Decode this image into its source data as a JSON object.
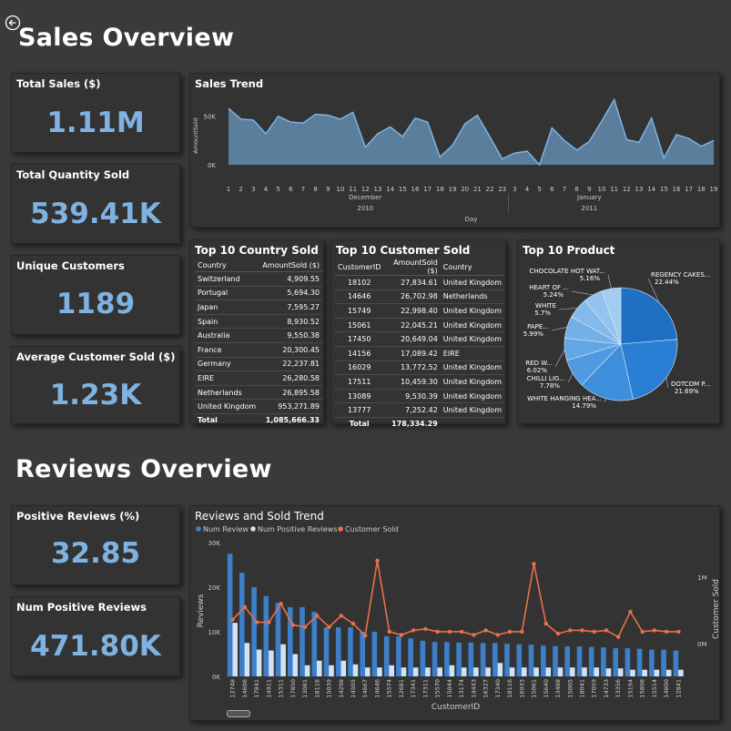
{
  "sales_overview": {
    "title": "Sales Overview",
    "kpis": [
      {
        "label": "Total Sales ($)",
        "value": "1.11M"
      },
      {
        "label": "Total Quantity Sold",
        "value": "539.41K"
      },
      {
        "label": "Unique Customers",
        "value": "1189"
      },
      {
        "label": "Average Customer Sold ($)",
        "value": "1.23K"
      }
    ],
    "sales_trend": {
      "title": "Sales Trend",
      "chart_data": {
        "type": "area",
        "ylabel": "AmountSold",
        "xlabel": "Day",
        "y_ticks": [
          "0K",
          "50K"
        ],
        "ylim": [
          0,
          75000
        ],
        "x": [
          "1",
          "2",
          "3",
          "4",
          "5",
          "6",
          "7",
          "8",
          "9",
          "10",
          "11",
          "12",
          "13",
          "14",
          "15",
          "16",
          "17",
          "18",
          "19",
          "20",
          "21",
          "22",
          "23",
          "3",
          "4",
          "5",
          "6",
          "7",
          "8",
          "9",
          "10",
          "11",
          "12",
          "13",
          "14",
          "15",
          "16",
          "17",
          "18",
          "19"
        ],
        "months": [
          {
            "label": "December",
            "year": "2010"
          },
          {
            "label": "January",
            "year": "2011"
          }
        ],
        "values": [
          58000,
          47000,
          46000,
          32000,
          50000,
          44000,
          43000,
          52000,
          51000,
          47000,
          54000,
          18000,
          32000,
          39000,
          29000,
          48000,
          44000,
          8000,
          20000,
          42000,
          51000,
          29000,
          6000,
          12000,
          14000,
          0,
          38000,
          25000,
          15000,
          24000,
          45000,
          67000,
          26000,
          23000,
          48000,
          7000,
          31000,
          27000,
          19000,
          25000
        ]
      }
    },
    "country_table": {
      "title": "Top 10 Country Sold",
      "columns": [
        "Country",
        "AmountSold ($)"
      ],
      "rows": [
        [
          "Switzerland",
          "4,909.55"
        ],
        [
          "Portugal",
          "5,694.30"
        ],
        [
          "Japan",
          "7,595.27"
        ],
        [
          "Spain",
          "8,930.52"
        ],
        [
          "Australia",
          "9,550.38"
        ],
        [
          "France",
          "20,300.45"
        ],
        [
          "Germany",
          "22,237.81"
        ],
        [
          "EIRE",
          "26,280.58"
        ],
        [
          "Netherlands",
          "26,895.58"
        ],
        [
          "United Kingdom",
          "953,271.89"
        ]
      ],
      "total": [
        "Total",
        "1,085,666.33"
      ]
    },
    "customer_table": {
      "title": "Top 10 Customer Sold",
      "columns": [
        "CustomerID",
        "AmountSold ($)",
        "Country"
      ],
      "rows": [
        [
          "18102",
          "27,834.61",
          "United Kingdom"
        ],
        [
          "14646",
          "26,702.98",
          "Netherlands"
        ],
        [
          "15749",
          "22,998.40",
          "United Kingdom"
        ],
        [
          "15061",
          "22,045.21",
          "United Kingdom"
        ],
        [
          "17450",
          "20,649.04",
          "United Kingdom"
        ],
        [
          "14156",
          "17,089.42",
          "EIRE"
        ],
        [
          "16029",
          "13,772.52",
          "United Kingdom"
        ],
        [
          "17511",
          "10,459.30",
          "United Kingdom"
        ],
        [
          "13089",
          "9,530.39",
          "United Kingdom"
        ],
        [
          "13777",
          "7,252.42",
          "United Kingdom"
        ]
      ],
      "total": [
        "Total",
        "178,334.29",
        ""
      ]
    },
    "top_product": {
      "title": "Top 10 Product",
      "chart_data": {
        "type": "pie",
        "slices": [
          {
            "label": "REGENCY CAKES...",
            "value": 22.44,
            "pct": "22.44%",
            "color": "#1f6fc4"
          },
          {
            "label": "DOTCOM P...",
            "value": 21.69,
            "pct": "21.69%",
            "color": "#2a7fd4"
          },
          {
            "label": "WHITE HANGING HEA...",
            "value": 14.79,
            "pct": "14.79%",
            "color": "#3d8fdc"
          },
          {
            "label": "CHILLI LIG...",
            "value": 7.78,
            "pct": "7.78%",
            "color": "#4f9ae0"
          },
          {
            "label": "RED W...",
            "value": 6.02,
            "pct": "6.02%",
            "color": "#62a6e4"
          },
          {
            "label": "PAPE...",
            "value": 5.99,
            "pct": "5.99%",
            "color": "#73b0e8"
          },
          {
            "label": "WHITE",
            "value": 5.7,
            "pct": "5.7%",
            "color": "#84baeb"
          },
          {
            "label": "HEART OF ...",
            "value": 5.24,
            "pct": "5.24%",
            "color": "#93c3ee"
          },
          {
            "label": "CHOCOLATE HOT WAT...",
            "value": 5.16,
            "pct": "5.16%",
            "color": "#a3ccf1"
          }
        ]
      }
    }
  },
  "reviews_overview": {
    "title": "Reviews Overview",
    "kpis": [
      {
        "label": "Positive Reviews (%)",
        "value": "32.85"
      },
      {
        "label": "Num Positive Reviews",
        "value": "471.80K"
      }
    ],
    "trend": {
      "title": "Reviews and Sold Trend",
      "chart_data": {
        "type": "bar",
        "xlabel": "CustomerID",
        "ylabel": "Reviews",
        "y2label": "Customer Sold",
        "y_ticks": [
          "0K",
          "10K",
          "20K",
          "30K"
        ],
        "ylim": [
          0,
          30000
        ],
        "y2_ticks": [
          "0M",
          "1M"
        ],
        "legend": [
          "Num Review",
          "Num Positive Reviews",
          "Customer Sold"
        ],
        "colors": {
          "num_review": "#3d7fc9",
          "num_positive": "#cfe3f7",
          "customer_sold": "#e8714c"
        },
        "categories": [
          "12748",
          "14606",
          "17841",
          "14911",
          "15311",
          "17850",
          "13081",
          "18118",
          "15039",
          "14298",
          "14505",
          "14667",
          "14646",
          "15574",
          "12681",
          "17341",
          "17311",
          "15570",
          "15044",
          "13174",
          "14443",
          "16327",
          "17340",
          "18116",
          "16033",
          "15061",
          "15640",
          "13488",
          "15005",
          "18041",
          "17059",
          "14733",
          "13356",
          "15194",
          "15808",
          "15514",
          "14800",
          "12841"
        ],
        "series": [
          {
            "name": "Num Review",
            "values": [
              27500,
              23200,
              20000,
              18000,
              16500,
              15500,
              15500,
              14500,
              11000,
              11000,
              11000,
              10000,
              10000,
              9000,
              9000,
              8500,
              8000,
              7700,
              7700,
              7600,
              7600,
              7500,
              7500,
              7300,
              7200,
              7100,
              6900,
              6800,
              6700,
              6700,
              6600,
              6500,
              6300,
              6300,
              6200,
              6000,
              6000,
              5800
            ]
          },
          {
            "name": "Num Positive Reviews",
            "values": [
              12000,
              7500,
              6000,
              5800,
              7200,
              5000,
              2500,
              3500,
              2500,
              3500,
              2700,
              2000,
              2000,
              2500,
              2000,
              2000,
              2000,
              2000,
              2500,
              2000,
              2000,
              2000,
              3000,
              2000,
              2000,
              2000,
              2000,
              2000,
              2000,
              2000,
              2000,
              1800,
              1800,
              1500,
              1500,
              1500,
              1500,
              1500
            ]
          },
          {
            "name": "Customer Sold",
            "values": [
              0.36,
              0.55,
              0.32,
              0.32,
              0.6,
              0.28,
              0.25,
              0.42,
              0.25,
              0.42,
              0.3,
              0.12,
              1.25,
              0.18,
              0.13,
              0.2,
              0.22,
              0.18,
              0.18,
              0.18,
              0.13,
              0.2,
              0.13,
              0.18,
              0.18,
              1.2,
              0.3,
              0.15,
              0.2,
              0.2,
              0.18,
              0.2,
              0.1,
              0.48,
              0.18,
              0.2,
              0.18,
              0.18
            ]
          }
        ]
      }
    }
  }
}
